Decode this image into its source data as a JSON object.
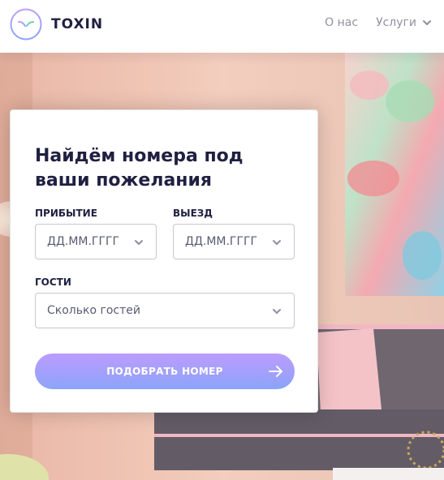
{
  "header": {
    "logo_text": "TOXIN",
    "logo_icon": "toxin-logo-icon",
    "nav": [
      {
        "label": "О нас"
      },
      {
        "label": "Услуги",
        "icon": "chevron-down-icon"
      }
    ]
  },
  "search_card": {
    "title": "Найдём номера под ваши пожелания",
    "arrival": {
      "label": "ПРИБЫТИЕ",
      "placeholder": "ДД.ММ.ГГГГ"
    },
    "departure": {
      "label": "ВЫЕЗД",
      "placeholder": "ДД.ММ.ГГГГ"
    },
    "guests": {
      "label": "ГОСТИ",
      "placeholder": "Сколько гостей"
    },
    "submit": {
      "label": "ПОДОБРАТЬ НОМЕР",
      "icon": "arrow-right-icon"
    }
  },
  "colors": {
    "dark": "#1f2041",
    "accent_start": "#bc9cff",
    "accent_end": "#8ba4f9"
  }
}
